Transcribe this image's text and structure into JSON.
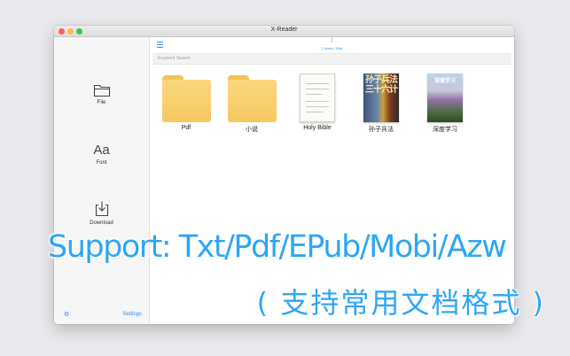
{
  "window": {
    "title": "X-Reader"
  },
  "sidebar": {
    "file_label": "File",
    "font_glyph": "Aa",
    "font_label": "Font",
    "download_label": "Download",
    "settings_label": "Settings",
    "gear_glyph": "⚙"
  },
  "topbar": {
    "path": "/",
    "counts": "2 folder, 3 file",
    "search_placeholder": "Keyword Search"
  },
  "items": [
    {
      "name": "Pdf",
      "kind": "folder"
    },
    {
      "name": "小说",
      "kind": "folder"
    },
    {
      "name": "Holy Bible",
      "kind": "book"
    },
    {
      "name": "孙子兵法",
      "kind": "book",
      "cover_text": "孙子兵法三十六计"
    },
    {
      "name": "深度学习",
      "kind": "book",
      "cover_text": "深度学习"
    }
  ],
  "promo": {
    "headline": "Support: Txt/Pdf/EPub/Mobi/Azw",
    "subline": "( 支持常用文档格式 )"
  },
  "colors": {
    "accent": "#2b8ff0",
    "promo": "#2ea6f2",
    "folder": "#f6c85f"
  }
}
